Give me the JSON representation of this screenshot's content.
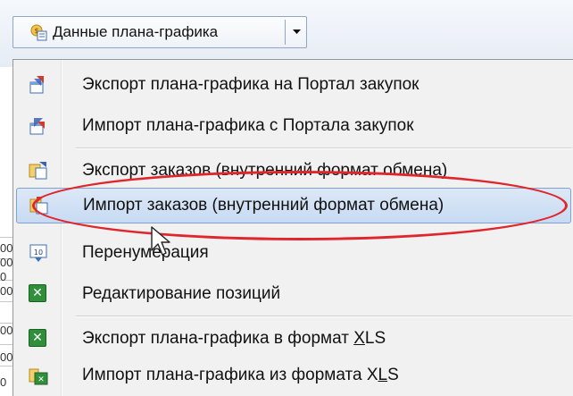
{
  "toolbar": {
    "button_label": "Данные плана-графика",
    "button_icon": "plan-data-icon",
    "dropdown_icon": "chevron-down-icon"
  },
  "background_cells": [
    "00",
    "00",
    "0",
    "00",
    "00",
    "00",
    "0"
  ],
  "menu": {
    "items": [
      {
        "label": "Экспорт плана-графика на Портал закупок",
        "icon": "export-portal-icon"
      },
      {
        "label": "Импорт плана-графика с Портала закупок",
        "icon": "import-portal-icon"
      },
      {
        "label": "Экспорт заказов (внутренний формат обмена)",
        "icon": "export-orders-icon"
      },
      {
        "label": "Импорт заказов (внутренний формат обмена)",
        "icon": "import-orders-icon",
        "highlighted": true
      },
      {
        "label": "Перенумерация",
        "icon": "renumber-icon"
      },
      {
        "label": "Редактирование позиций",
        "icon": "excel-icon"
      },
      {
        "label": "Экспорт плана-графика в формат ",
        "label_accel": "X",
        "label_tail": "LS",
        "icon": "excel-export-icon"
      },
      {
        "label": "Импорт плана-графика из формата X",
        "label_accel": "L",
        "label_tail": "S",
        "icon": "excel-import-icon"
      }
    ]
  },
  "colors": {
    "highlight_bg": "#c8daf2",
    "highlight_border": "#7ea3d3",
    "annotation": "#e0262c",
    "excel_green": "#2f8f3a"
  }
}
